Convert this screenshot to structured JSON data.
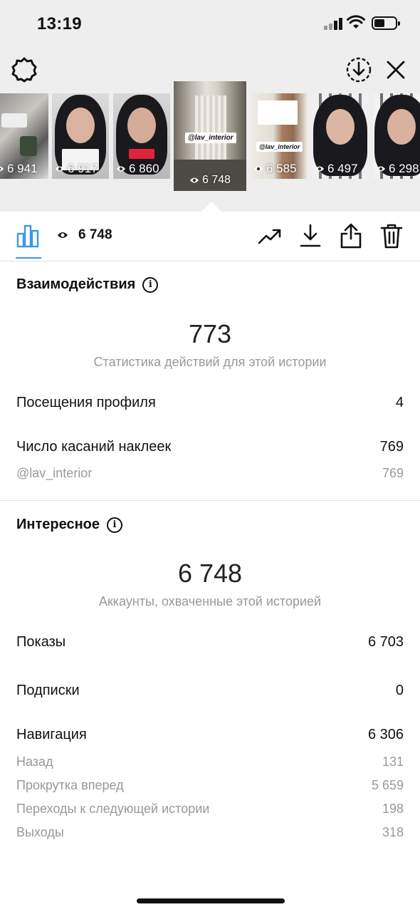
{
  "status_bar": {
    "time": "13:19"
  },
  "stories": [
    {
      "views": "6 941"
    },
    {
      "views": "6 917"
    },
    {
      "views": "6 860"
    },
    {
      "views": "6 748",
      "tag": "@lav_interior",
      "selected": true
    },
    {
      "views": "6 585",
      "tag": "@lav_interior"
    },
    {
      "views": "6 497"
    },
    {
      "views": "6 298"
    }
  ],
  "toolbar": {
    "views": "6 748"
  },
  "interactions": {
    "title": "Взаимодействия",
    "total": "773",
    "caption": "Статистика действий для этой истории",
    "rows": [
      {
        "label": "Посещения профиля",
        "value": "4"
      },
      {
        "label": "Число касаний наклеек",
        "value": "769"
      }
    ],
    "sticker": {
      "label": "@lav_interior",
      "value": "769"
    }
  },
  "discovery": {
    "title": "Интересное",
    "total": "6 748",
    "caption": "Аккаунты, охваченные этой историей",
    "impressions": {
      "label": "Показы",
      "value": "6 703"
    },
    "follows": {
      "label": "Подписки",
      "value": "0"
    },
    "navigation": {
      "label": "Навигация",
      "value": "6 306"
    },
    "nav_details": [
      {
        "label": "Назад",
        "value": "131"
      },
      {
        "label": "Прокрутка вперед",
        "value": "5 659"
      },
      {
        "label": "Переходы к следующей истории",
        "value": "198"
      },
      {
        "label": "Выходы",
        "value": "318"
      }
    ]
  }
}
